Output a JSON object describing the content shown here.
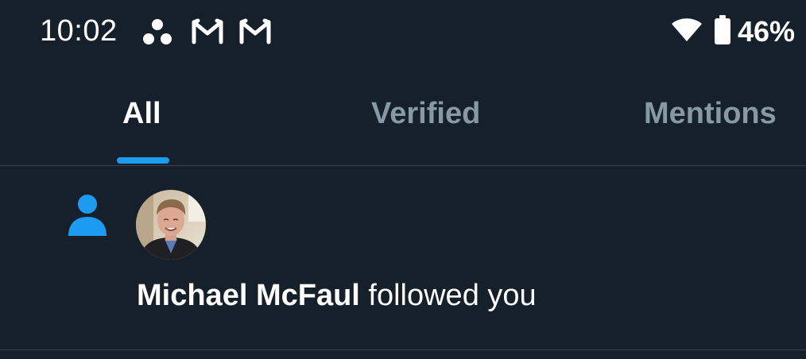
{
  "status_bar": {
    "time": "10:02",
    "notification_icons": [
      "cluster-app-icon",
      "gmail-icon",
      "gmail-icon"
    ],
    "wifi_icon": "wifi-icon",
    "battery_icon": "battery-icon",
    "battery_percent": "46%"
  },
  "tabs": [
    {
      "label": "All",
      "active": true
    },
    {
      "label": "Verified",
      "active": false
    },
    {
      "label": "Mentions",
      "active": false
    }
  ],
  "notifications": [
    {
      "type_icon": "person-icon",
      "avatar": "avatar",
      "user_name": "Michael McFaul",
      "action_text": " followed you"
    }
  ],
  "colors": {
    "background": "#15202b",
    "accent": "#1d9bf0",
    "inactive_tab": "#8899a6",
    "divider": "#38444d",
    "text": "#ffffff"
  }
}
